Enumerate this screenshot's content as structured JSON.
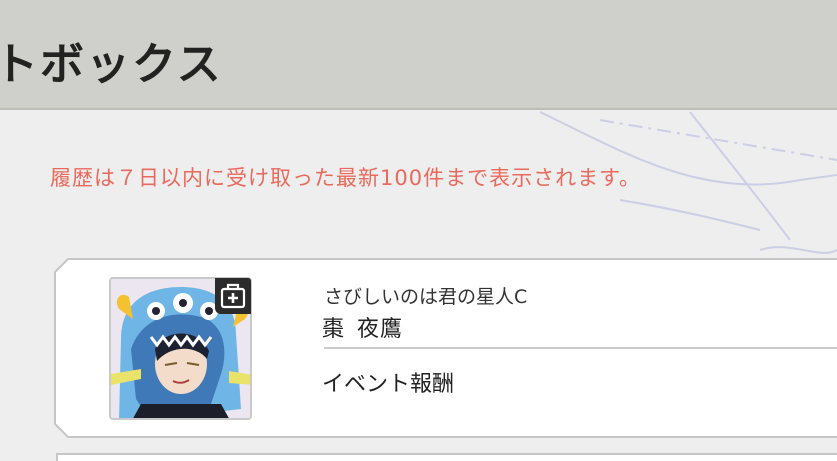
{
  "header": {
    "title": "トボックス"
  },
  "notice": {
    "text": "履歴は７日以内に受け取った最新100件まで表示されます。"
  },
  "items": [
    {
      "subtitle": "さびしいのは君の星人C",
      "name_family": "棗",
      "name_given": "夜鷹",
      "reward": "イベント報酬",
      "badge_icon": "item-box-plus-icon"
    }
  ],
  "colors": {
    "header_bg": "#cfcfcb",
    "notice": "#e96a5c",
    "page_bg": "#eeeeee",
    "card_bg": "#ffffff"
  }
}
